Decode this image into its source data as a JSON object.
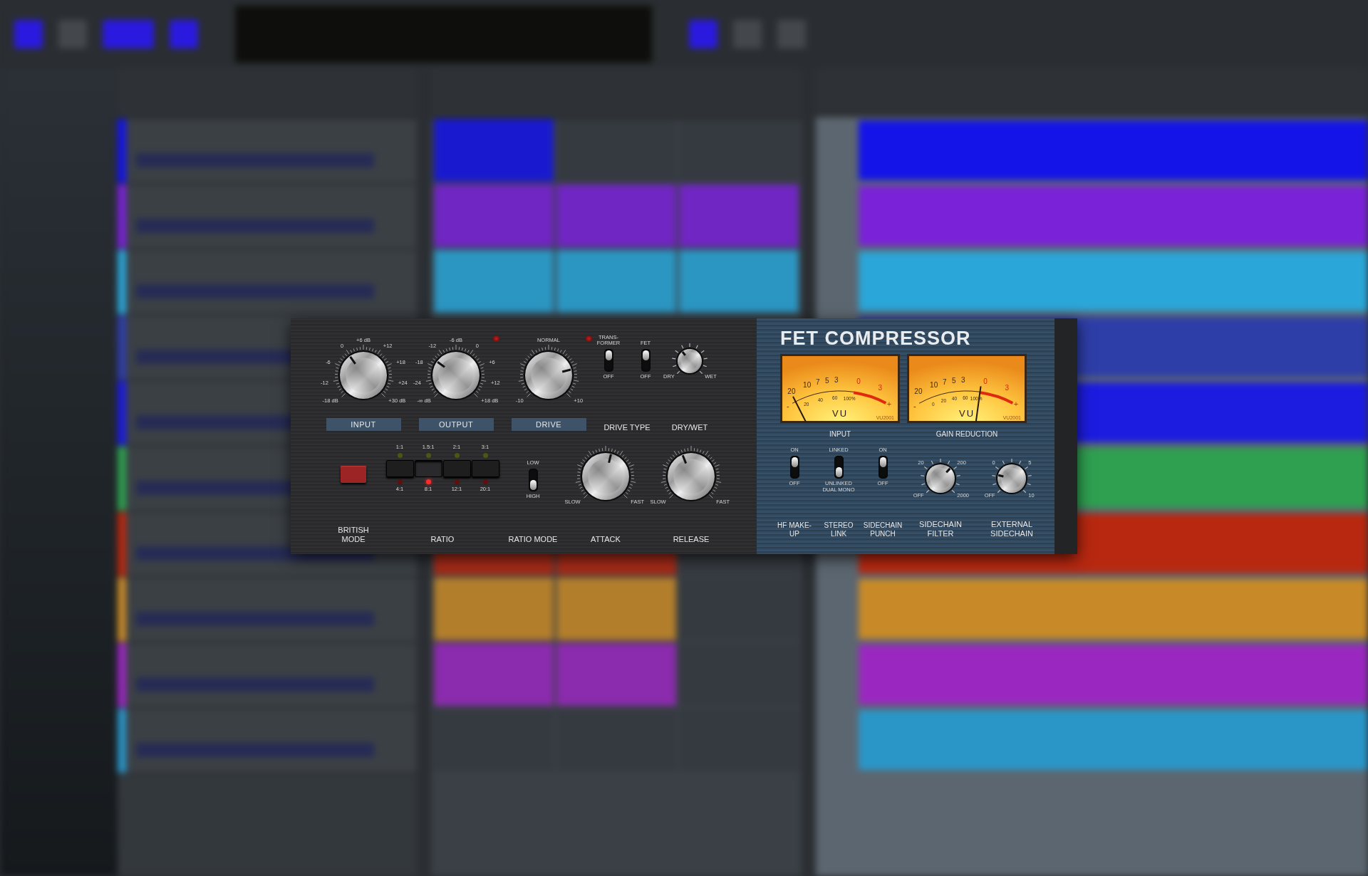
{
  "tracks": [
    {
      "color": "#1414e8",
      "scene_clips": [
        true,
        false,
        false
      ]
    },
    {
      "color": "#7a22d8",
      "scene_clips": [
        true,
        true,
        true
      ]
    },
    {
      "color": "#2aa6d8",
      "scene_clips": [
        true,
        true,
        true
      ]
    },
    {
      "color": "#2e3ea8"
    },
    {
      "color": "#1c1ce0"
    },
    {
      "color": "#2fa050"
    },
    {
      "color": "#b82810",
      "scene_clips": [
        true,
        true,
        false
      ]
    },
    {
      "color": "#c88a28",
      "scene_clips": [
        true,
        true,
        false
      ]
    },
    {
      "color": "#9a28c0",
      "scene_clips": [
        true,
        true,
        false
      ]
    },
    {
      "color": "#2a96c8",
      "scene_clips": [
        false,
        false,
        false
      ]
    }
  ],
  "plugin": {
    "title": "FET COMPRESSOR",
    "top_knobs": [
      {
        "label": "INPUT",
        "level": 0.37,
        "led": false,
        "scale": [
          "+6 dB",
          "0",
          "+12",
          "-6",
          "+18",
          "-12",
          "+24",
          "-18 dB",
          "+30 dB"
        ]
      },
      {
        "label": "OUTPUT",
        "level": 0.3,
        "led": true,
        "scale": [
          "-6 dB",
          "-12",
          "0",
          "-18",
          "+6",
          "-24",
          "+12",
          "-∞ dB",
          "+18 dB"
        ]
      },
      {
        "label": "DRIVE",
        "level": 0.78,
        "led": true,
        "scale": [
          "NORMAL",
          "-10",
          "+10"
        ]
      }
    ],
    "drive_type": {
      "label": "DRIVE TYPE",
      "switches": [
        {
          "name": "TRANS-FORMER",
          "off_label": "OFF",
          "on": true
        },
        {
          "name": "FET",
          "off_label": "OFF",
          "on": true
        }
      ]
    },
    "dry_wet": {
      "label": "DRY/WET",
      "level": 0.36,
      "scale": [
        "DRY",
        "WET"
      ]
    },
    "british_mode": {
      "label": "BRITISH MODE",
      "on": false
    },
    "ratio": {
      "label": "RATIO",
      "buttons": [
        {
          "low": "1:1",
          "high": "4:1",
          "selected": false
        },
        {
          "low": "1.5:1",
          "high": "8:1",
          "selected": true
        },
        {
          "low": "2:1",
          "high": "12:1",
          "selected": false
        },
        {
          "low": "3:1",
          "high": "20:1",
          "selected": false
        }
      ]
    },
    "ratio_mode": {
      "label": "RATIO MODE",
      "low_label": "LOW",
      "high_label": "HIGH",
      "high": true
    },
    "time_knobs": [
      {
        "label": "ATTACK",
        "level": 0.55,
        "scale": [
          "SLOW",
          "FAST"
        ]
      },
      {
        "label": "RELEASE",
        "level": 0.42,
        "scale": [
          "SLOW",
          "FAST"
        ]
      }
    ],
    "meters": [
      {
        "label": "INPUT",
        "level": 0.08,
        "upper_scale": [
          "20",
          "10",
          "7",
          "5",
          "3",
          "0",
          "3"
        ],
        "lower_scale": [
          "20",
          "40",
          "60",
          "100%"
        ],
        "unit": "VU",
        "minus": "-",
        "plus": "+",
        "model": "VU2001"
      },
      {
        "label": "GAIN REDUCTION",
        "level": 0.62,
        "upper_scale": [
          "20",
          "10",
          "7",
          "5",
          "3",
          "0",
          "3"
        ],
        "lower_scale": [
          "0",
          "20",
          "40",
          "60",
          "100%"
        ],
        "unit": "VU",
        "minus": "-",
        "plus": "+",
        "model": "VU2001"
      }
    ],
    "sidechain": [
      {
        "kind": "toggle",
        "label": "HF MAKE-UP",
        "on_label": "ON",
        "off_label": "OFF",
        "on": true
      },
      {
        "kind": "toggle",
        "label": "STEREO LINK",
        "on_label": "LINKED",
        "off_label": "UNLINKED DUAL MONO",
        "on": false
      },
      {
        "kind": "toggle",
        "label": "SIDECHAIN PUNCH",
        "on_label": "ON",
        "off_label": "OFF",
        "on": true
      },
      {
        "kind": "knob",
        "label": "SIDECHAIN FILTER",
        "level": 0.66,
        "scale": [
          "20",
          "200",
          "OFF",
          "2000"
        ]
      },
      {
        "kind": "knob",
        "label": "EXTERNAL SIDECHAIN",
        "level": 0.22,
        "scale": [
          "0",
          "5",
          "OFF",
          "10"
        ]
      }
    ]
  }
}
